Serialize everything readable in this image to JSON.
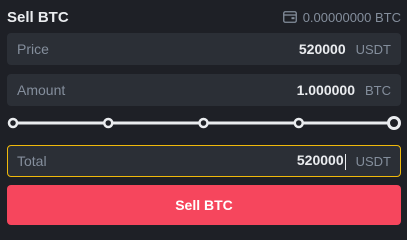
{
  "header": {
    "title": "Sell BTC",
    "balance": "0.00000000 BTC",
    "balance_icon": "wallet-icon"
  },
  "price": {
    "label": "Price",
    "value": "520000",
    "unit": "USDT"
  },
  "amount": {
    "label": "Amount",
    "value": "1.000000",
    "unit": "BTC"
  },
  "slider": {
    "stops": [
      0,
      25,
      50,
      75,
      100
    ],
    "value_percent": 100
  },
  "total": {
    "label": "Total",
    "value": "520000",
    "unit": "USDT"
  },
  "action": {
    "sell_label": "Sell BTC"
  },
  "colors": {
    "background": "#1e2026",
    "field": "#2b2f36",
    "sell": "#f6465d",
    "focus_border": "#f0b90b"
  }
}
